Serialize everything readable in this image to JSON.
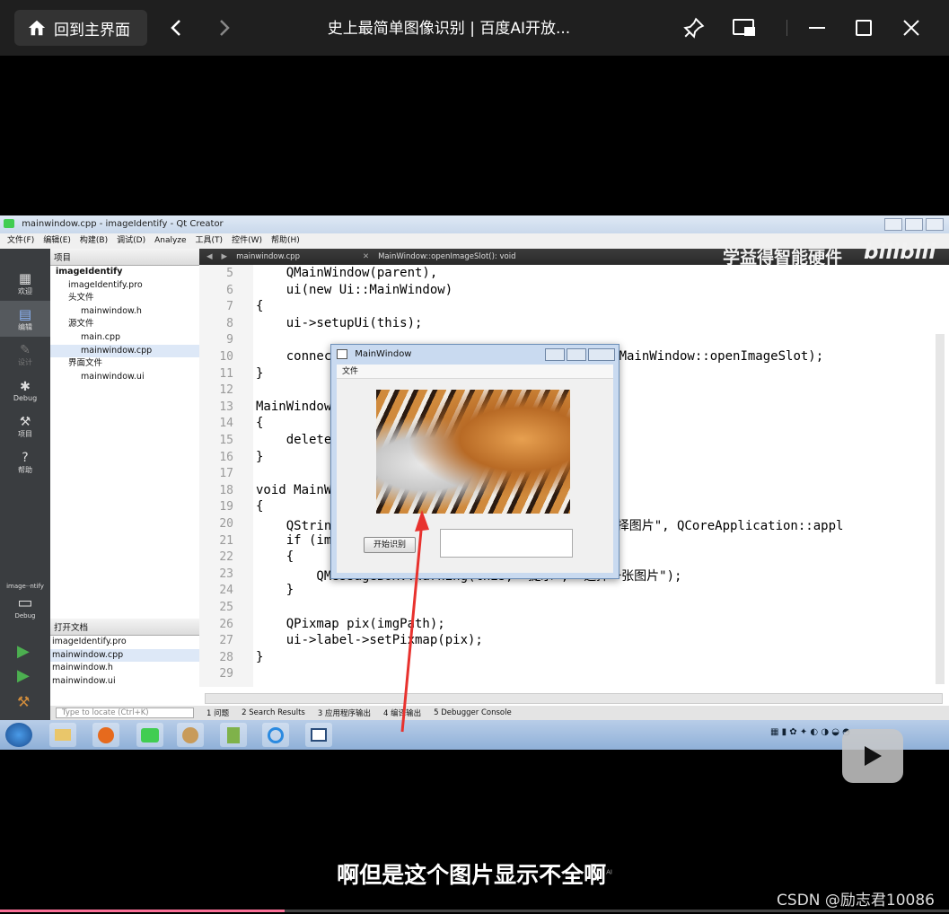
{
  "player": {
    "home_label": "回到主界面",
    "video_title": "史上最简单图像识别 | 百度AI开放...",
    "progress_fraction": 0.3
  },
  "qt": {
    "window_title": "mainwindow.cpp - imageIdentify - Qt Creator",
    "menu": [
      "文件(F)",
      "编辑(E)",
      "构建(B)",
      "调试(D)",
      "Analyze",
      "工具(T)",
      "控件(W)",
      "帮助(H)"
    ],
    "modes": [
      "欢迎",
      "编辑",
      "设计",
      "Debug",
      "项目",
      "帮助"
    ],
    "kit_label": "image··ntify",
    "kit_mode": "Debug",
    "project_header": "项目",
    "tree": [
      {
        "label": "imageIdentify",
        "indent": 0
      },
      {
        "label": "imageIdentify.pro",
        "indent": 1
      },
      {
        "label": "头文件",
        "indent": 1
      },
      {
        "label": "mainwindow.h",
        "indent": 2
      },
      {
        "label": "源文件",
        "indent": 1
      },
      {
        "label": "main.cpp",
        "indent": 2
      },
      {
        "label": "mainwindow.cpp",
        "indent": 2
      },
      {
        "label": "界面文件",
        "indent": 1
      },
      {
        "label": "mainwindow.ui",
        "indent": 2
      }
    ],
    "open_docs_header": "打开文档",
    "open_docs": [
      "imageIdentify.pro",
      "mainwindow.cpp",
      "mainwindow.h",
      "mainwindow.ui"
    ],
    "editor_tab": "mainwindow.cpp",
    "editor_function": "MainWindow::openImageSlot(): void",
    "brand_overlay": "学益得智能硬件",
    "bilibili_overlay": "bilibili",
    "locate_placeholder": "Type to locate (Ctrl+K)",
    "output_tabs": [
      "1 问题",
      "2 Search Results",
      "3 应用程序输出",
      "4 编译输出",
      "5 Debugger Console"
    ]
  },
  "code_lines": [
    {
      "n": "5",
      "text": "    QMainWindow(parent),"
    },
    {
      "n": "6",
      "text": "    ui(new Ui::MainWindow)"
    },
    {
      "n": "7",
      "text": "{"
    },
    {
      "n": "8",
      "text": "    ui->setupUi(this);"
    },
    {
      "n": "9",
      "text": ""
    },
    {
      "n": "10",
      "text": "    connect(                               is, &MainWindow::openImageSlot);"
    },
    {
      "n": "11",
      "text": "}"
    },
    {
      "n": "12",
      "text": ""
    },
    {
      "n": "13",
      "text": "MainWindow"
    },
    {
      "n": "14",
      "text": "{"
    },
    {
      "n": "15",
      "text": "    delete"
    },
    {
      "n": "16",
      "text": "}"
    },
    {
      "n": "17",
      "text": ""
    },
    {
      "n": "18",
      "text": "void MainW"
    },
    {
      "n": "19",
      "text": "{"
    },
    {
      "n": "20",
      "text": "    QStrin                         ame(this, \"选择图片\", QCoreApplication::appl"
    },
    {
      "n": "21",
      "text": "    if (im"
    },
    {
      "n": "22",
      "text": "    {"
    },
    {
      "n": "23",
      "text": "        QMessageBox::warning(this, \"提示\", \"选择一张图片\");"
    },
    {
      "n": "24",
      "text": "    }"
    },
    {
      "n": "25",
      "text": ""
    },
    {
      "n": "26",
      "text": "    QPixmap pix(imgPath);"
    },
    {
      "n": "27",
      "text": "    ui->label->setPixmap(pix);"
    },
    {
      "n": "28",
      "text": "}"
    },
    {
      "n": "29",
      "text": ""
    }
  ],
  "popup": {
    "title": "MainWindow",
    "menu_file": "文件",
    "start_button": "开始识别"
  },
  "caption": {
    "subtitle": "啊但是这个图片显示不全啊",
    "ai_mark": "AI",
    "watermark": "CSDN @励志君10086"
  }
}
